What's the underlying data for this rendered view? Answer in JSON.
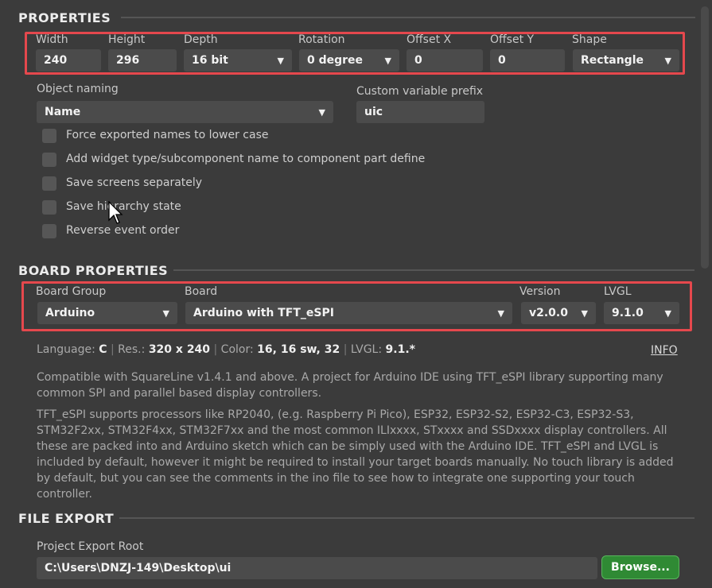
{
  "properties": {
    "title": "PROPERTIES",
    "width": {
      "label": "Width",
      "value": "240"
    },
    "height": {
      "label": "Height",
      "value": "296"
    },
    "depth": {
      "label": "Depth",
      "value": "16 bit"
    },
    "rotation": {
      "label": "Rotation",
      "value": "0 degree"
    },
    "offset_x": {
      "label": "Offset X",
      "value": "0"
    },
    "offset_y": {
      "label": "Offset Y",
      "value": "0"
    },
    "shape": {
      "label": "Shape",
      "value": "Rectangle"
    },
    "object_naming": {
      "label": "Object naming",
      "value": "Name"
    },
    "custom_prefix": {
      "label": "Custom variable prefix",
      "value": "uic"
    },
    "checkboxes": [
      "Force exported names to lower case",
      "Add widget type/subcomponent name to component part define",
      "Save screens separately",
      "Save hierarchy state",
      "Reverse event order"
    ]
  },
  "board_properties": {
    "title": "BOARD PROPERTIES",
    "board_group": {
      "label": "Board Group",
      "value": "Arduino"
    },
    "board": {
      "label": "Board",
      "value": "Arduino with TFT_eSPI"
    },
    "version": {
      "label": "Version",
      "value": "v2.0.0"
    },
    "lvgl": {
      "label": "LVGL",
      "value": "9.1.0"
    },
    "summary": {
      "language_label": "Language:",
      "language": "C",
      "res_label": "Res.:",
      "res": "320 x 240",
      "color_label": "Color:",
      "color": "16, 16 sw, 32",
      "lvgl_label": "LVGL:",
      "lvgl": "9.1.*"
    },
    "info_link": "INFO",
    "description_1": "Compatible with SquareLine v1.4.1 and above. A project for Arduino IDE using TFT_eSPI library supporting many common SPI and parallel based display controllers.",
    "description_2": "TFT_eSPI supports processors like RP2040, (e.g. Raspberry Pi Pico), ESP32, ESP32-S2, ESP32-C3, ESP32-S3, STM32F2xx, STM32F4xx, STM32F7xx and the most common ILIxxxx, STxxxx and SSDxxxx display controllers. All these are packed into and Arduino sketch which can be simply used with the Arduino IDE. TFT_eSPI and LVGL is included by default, however it might be required to install your target boards manually.  No touch library is added by default, but you can see the comments in the ino file to see how to integrate one supporting your touch controller."
  },
  "file_export": {
    "title": "FILE EXPORT",
    "root_label": "Project Export Root",
    "root_value": "C:\\Users\\DNZJ-149\\Desktop\\ui",
    "browse_label": "Browse..."
  },
  "colors": {
    "background": "#3b3b3b",
    "field": "#4b4b4b",
    "highlight": "#e5484d",
    "browse": "#2f8a34"
  }
}
